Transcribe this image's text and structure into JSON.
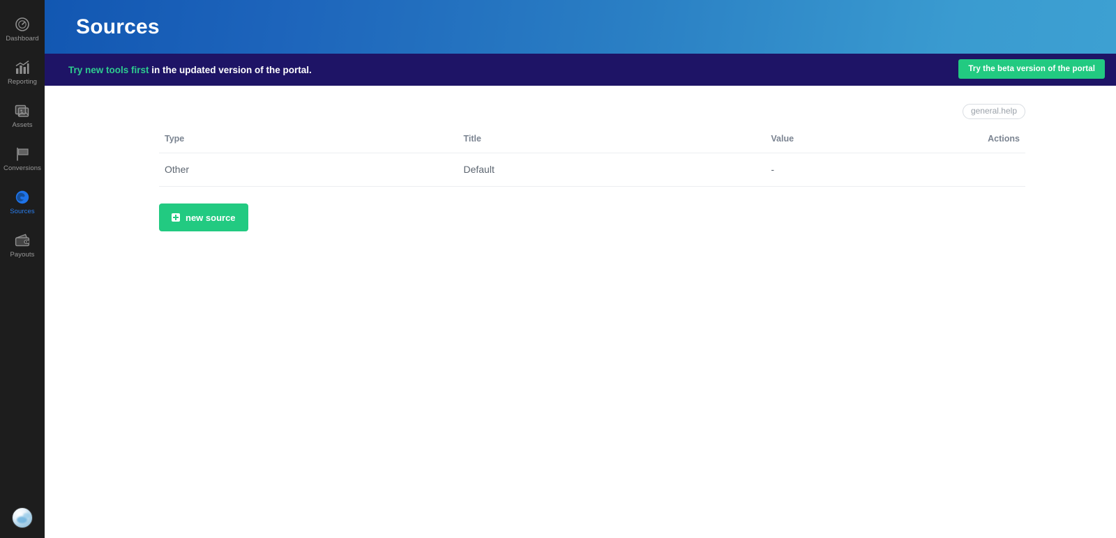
{
  "sidebar": {
    "items": [
      {
        "label": "Dashboard",
        "icon": "gauge-icon",
        "active": false
      },
      {
        "label": "Reporting",
        "icon": "bar-chart-icon",
        "active": false
      },
      {
        "label": "Assets",
        "icon": "images-icon",
        "active": false
      },
      {
        "label": "Conversions",
        "icon": "flag-icon",
        "active": false
      },
      {
        "label": "Sources",
        "icon": "globe-icon",
        "active": true
      },
      {
        "label": "Payouts",
        "icon": "wallet-icon",
        "active": false
      }
    ],
    "avatar": {
      "name": "user-avatar"
    }
  },
  "header": {
    "title": "Sources",
    "gradient_from": "#1257b2",
    "gradient_to": "#3da0d2"
  },
  "banner": {
    "highlight": "Try new tools first",
    "rest": " in the updated version of the portal.",
    "background": "#1e1466",
    "highlight_color": "#2ecc8f",
    "button_label": "Try the beta version of the portal",
    "button_color": "#22ca81"
  },
  "content": {
    "help_label": "general.help",
    "table": {
      "columns": [
        "Type",
        "Title",
        "Value",
        "Actions"
      ],
      "rows": [
        {
          "type": "Other",
          "title": "Default",
          "value": "-",
          "actions": ""
        }
      ]
    },
    "new_source_label": "new source",
    "new_source_color": "#22ca81"
  }
}
